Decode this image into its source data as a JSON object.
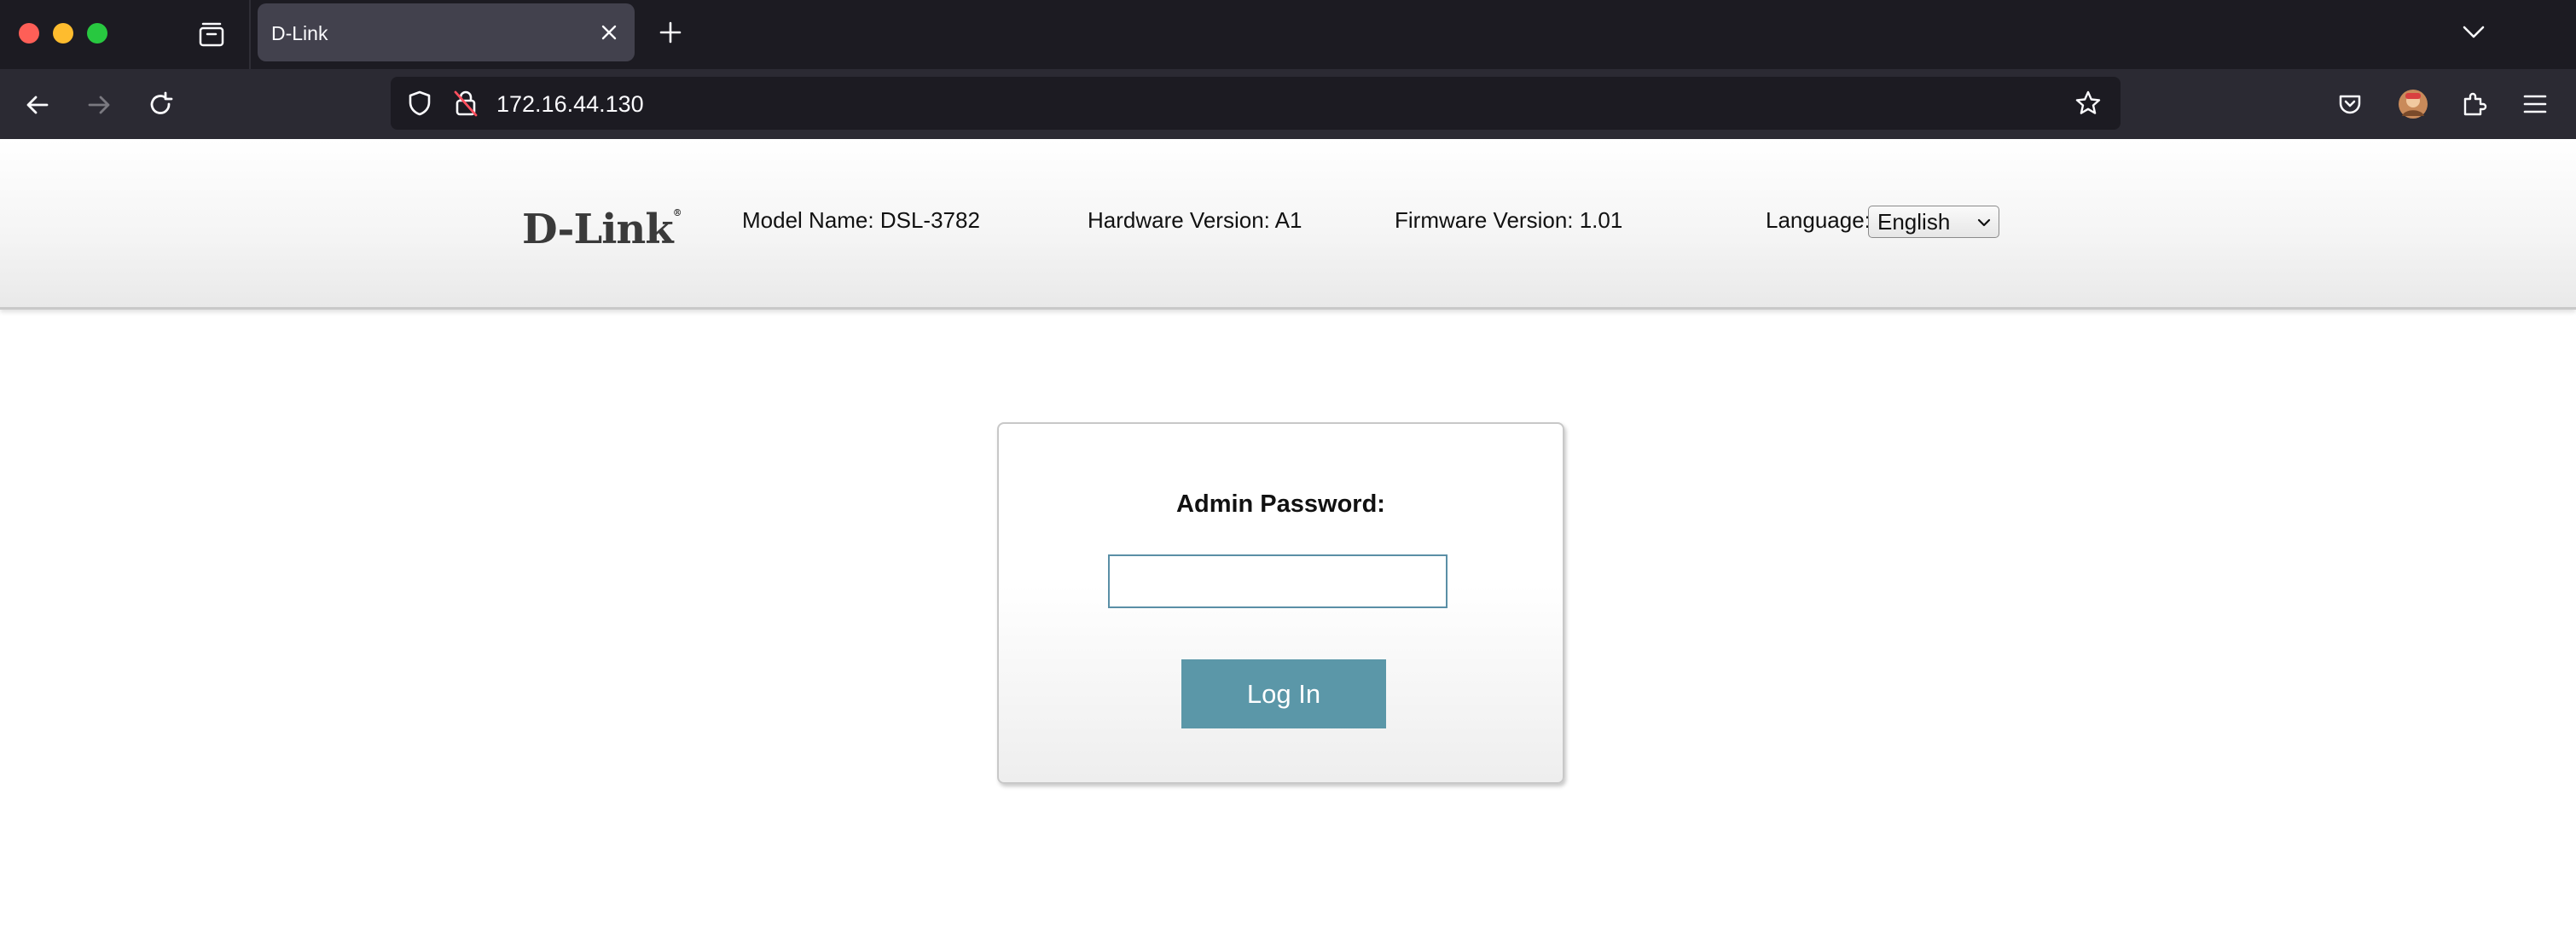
{
  "browser": {
    "tab_title": "D-Link",
    "url": "172.16.44.130"
  },
  "header": {
    "logo": "D-Link",
    "model_name": "Model Name: DSL-3782",
    "hardware_version": "Hardware Version: A1",
    "firmware_version": "Firmware Version: 1.01",
    "language_label": "Language:",
    "language_selected": "English"
  },
  "login": {
    "password_label": "Admin Password:",
    "password_value": "",
    "login_button": "Log In"
  },
  "colors": {
    "button": "#5b97a8",
    "chrome_dark": "#1c1b22",
    "chrome_nav": "#2b2a33"
  }
}
